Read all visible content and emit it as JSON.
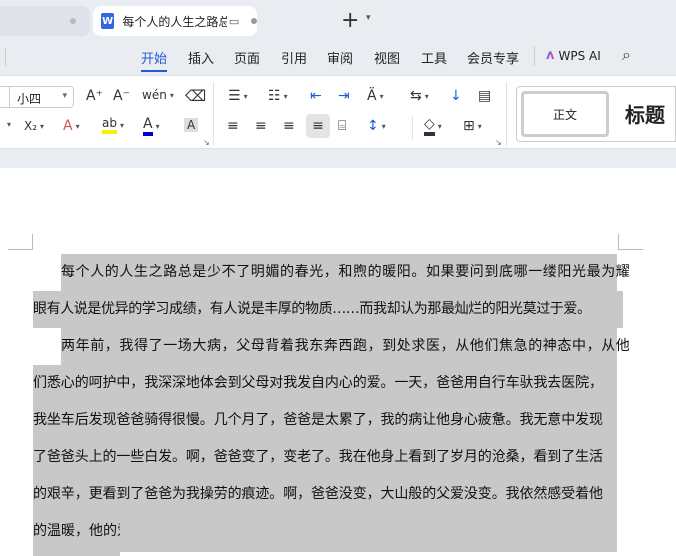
{
  "tabs": {
    "active_title": "每个人的人生之路总是少不了明",
    "doc_icon": "W"
  },
  "menu": [
    "开始",
    "插入",
    "页面",
    "引用",
    "审阅",
    "视图",
    "工具",
    "会员专享"
  ],
  "wps_ai": "WPS AI",
  "ribbon": {
    "font_size": "小四",
    "styles": {
      "normal": "正文",
      "heading": "标题"
    },
    "icons": {
      "grow": "A⁺",
      "shrink": "A⁻",
      "pinyin": "wén",
      "sub": "X₂",
      "text_effect": "A",
      "highlight": "ab",
      "font_color": "A",
      "char_shade": "A"
    },
    "colors": {
      "highlight": "#ffee00",
      "font_color": "#0000cc"
    }
  },
  "document": {
    "lines": [
      "每个人的人生之路总是少不了明媚的春光，和煦的暖阳。如果要问到底哪一缕阳光最为耀",
      "眼有人说是优异的学习成绩，有人说是丰厚的物质……而我却认为那最灿烂的阳光莫过于爱。",
      "两年前，我得了一场大病，父母背着我东奔西跑，到处求医，从他们焦急的神态中，从他",
      "们悉心的呵护中，我深深地体会到父母对我发自内心的爱。一天，爸爸用自行车驮我去医院，",
      "我坐车后发现爸爸骑得很慢。几个月了，爸爸是太累了，我的病让他身心疲惫。我无意中发现",
      "了爸爸头上的一些白发。啊，爸爸变了，变老了。我在他身上看到了岁月的沧桑，看到了生活",
      "的艰辛，更看到了爸爸为我操劳的痕迹。啊，爸爸没变，大山般的父爱没变。我依然感受着他",
      "的温暖，他的爱。"
    ]
  }
}
